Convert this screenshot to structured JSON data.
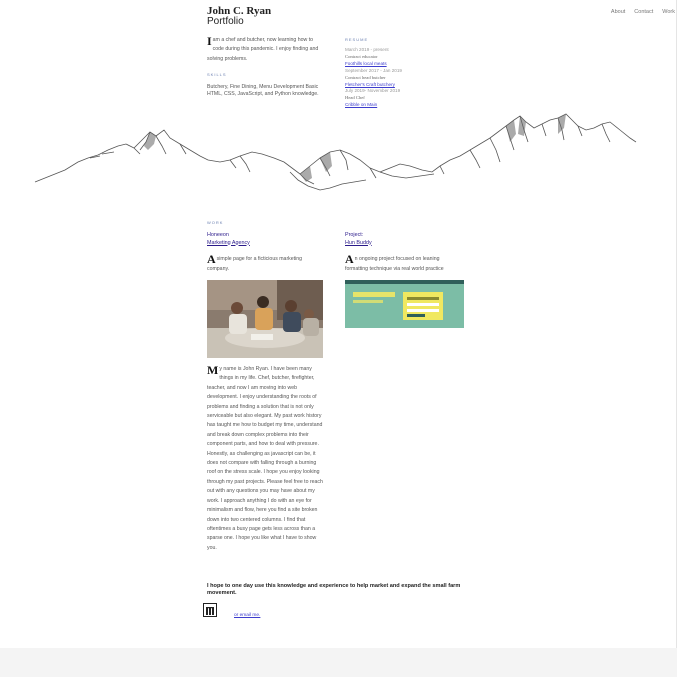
{
  "header": {
    "name": "John C. Ryan",
    "subtitle": "Portfolio"
  },
  "nav": {
    "items": [
      "About",
      "Contact",
      "Work"
    ]
  },
  "intro": {
    "dropcap": "I",
    "text": "am a chef and butcher, now learning how to code during this pandemic. I enjoy finding and solving problems."
  },
  "skills": {
    "heading": "SKILLS",
    "text": "Butchery, Fine Dining, Menu Development Basic HTML, CSS, JavaScript, and Python knowledge."
  },
  "resume": {
    "heading": "RESUME",
    "entries": [
      {
        "date": "March 2019 - present",
        "role": "Contract educator",
        "link": "Foothills local meats"
      },
      {
        "date": "September 2017 - Jan 2019",
        "role": "Contract head butcher",
        "link": "Fletcher's Craft butchery"
      },
      {
        "date": "July 2019- November 2019",
        "role": "Head Chef",
        "link": "Cribble on Main"
      }
    ]
  },
  "work": {
    "heading": "WORK",
    "project1": {
      "title_line1": "Honeeon",
      "title_line2": "Marketing Agency",
      "dropcap": "A",
      "text": "simple page for a ficticious marketing company."
    },
    "project2": {
      "title_line1": "Project:",
      "title_line2": "Hun Buddy",
      "dropcap": "A",
      "text": "n ongoing project focused on leaning formatting technique via real world practice"
    }
  },
  "bio": {
    "dropcap": "M",
    "text": "y name is John Ryan. I have been many things in my life. Chef, butcher, firefighter, teacher, and now I am moving into web development. I enjoy understanding the roots of problems and finding a solution that is not only serviceable but also elegant. My past work history has taught me how to budget my time, understand and break down complex problems into their component parts, and how to deal with pressure. Honestly, as challenging as javascript can be, it does not compare with falling through a burning roof on the stress scale. I hope you enjoy looking through my past projects. Please feel free to reach out with any questions you may have about my work. I approach anything I do with an eye for minimalism and flow, here you find a site broken down into two centered columns. I find that oftentimes a busy page gets less across than a sparse one. I hope you like what I have to show you."
  },
  "closing": {
    "text": "I hope to one day use this knowledge and experience to help market and expand the small farm movement."
  },
  "contact": {
    "email_label": "or email me."
  },
  "colors": {
    "link": "#3c3ccd",
    "heading": "#6a7fb0",
    "footer": "#f4f4f4"
  },
  "icons": {
    "logo": "jr-logo-icon"
  }
}
